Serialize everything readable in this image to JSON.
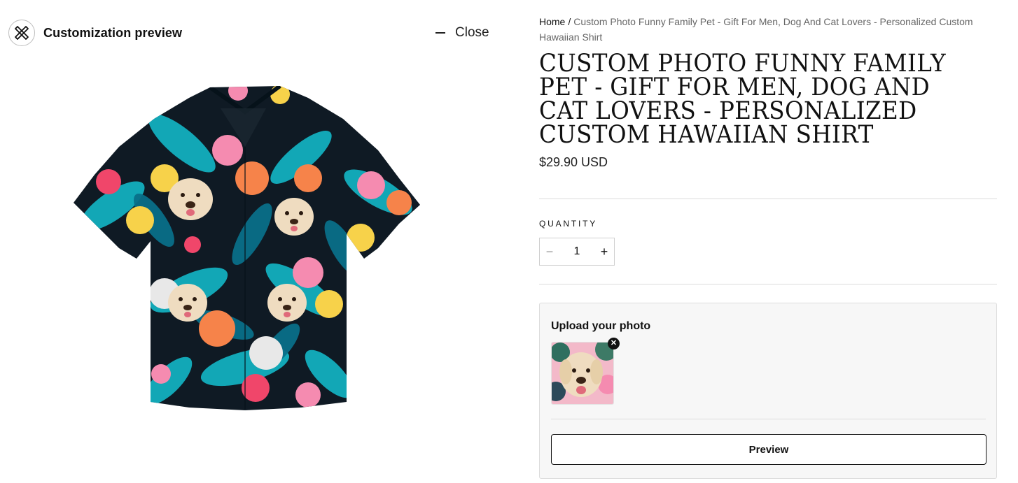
{
  "header": {
    "logo_icon": "brand-logo-icon",
    "title": "Customization preview",
    "close_label": "Close",
    "close_icon": "minus-icon"
  },
  "preview_image": {
    "icon": "hawaiian-shirt-image"
  },
  "breadcrumb": {
    "home": "Home",
    "separator": "/",
    "current": "Custom Photo Funny Family Pet - Gift For Men, Dog And Cat Lovers - Personalized Custom Hawaiian Shirt"
  },
  "product": {
    "title": "CUSTOM PHOTO FUNNY FAMILY PET - GIFT FOR MEN, DOG AND CAT LOVERS - PERSONALIZED CUSTOM HAWAIIAN SHIRT",
    "price": "$29.90 USD"
  },
  "quantity": {
    "label": "QUANTITY",
    "value": "1",
    "minus": "−",
    "plus": "+"
  },
  "upload": {
    "title": "Upload your photo",
    "remove_icon": "close-icon",
    "remove_label": "✕",
    "preview_button": "Preview"
  },
  "colors": {
    "shirt_background": "#0f1a24",
    "leaf_teal": "#14b8c8",
    "leaf_dark": "#0a6f8a",
    "hibiscus_red": "#f0466a",
    "hibiscus_orange": "#f6834a",
    "hibiscus_yellow": "#f7d24a",
    "hibiscus_pink": "#f58bb0",
    "dog_fur": "#efdcc0"
  }
}
